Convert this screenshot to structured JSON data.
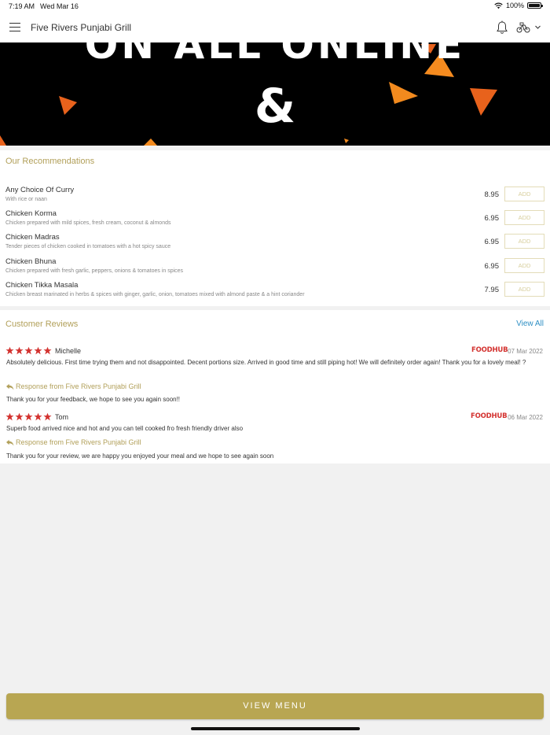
{
  "status_bar": {
    "time": "7:19 AM",
    "date": "Wed Mar 16",
    "battery": "100%"
  },
  "header": {
    "title": "Five Rivers Punjabi Grill"
  },
  "banner": {
    "text": "ON ALL ONLINE",
    "amp": "&"
  },
  "recommendations": {
    "title": "Our Recommendations",
    "add_label": "ADD",
    "items": [
      {
        "name": "Any Choice Of Curry",
        "description": "With rice or naan",
        "price": "8.95"
      },
      {
        "name": "Chicken Korma",
        "description": "Chicken prepared with mild spices, fresh cream, coconut & almonds",
        "price": "6.95"
      },
      {
        "name": "Chicken Madras",
        "description": "Tender pieces of chicken cooked in tomatoes with a hot spicy sauce",
        "price": "6.95"
      },
      {
        "name": "Chicken Bhuna",
        "description": "Chicken prepared with fresh garlic, peppers, onions & tomatoes in spices",
        "price": "6.95"
      },
      {
        "name": "Chicken Tikka Masala",
        "description": "Chicken breast marinated in herbs & spices with ginger, garlic, onion, tomatoes mixed with almond paste & a hint coriander",
        "price": "7.95"
      }
    ]
  },
  "reviews": {
    "title": "Customer Reviews",
    "view_all": "View All",
    "items": [
      {
        "rating": 5,
        "reviewer": "Michelle",
        "source": "FOODHUB",
        "date": "07 Mar 2022",
        "text": "Absolutely delicious. First time trying them and not disappointed. Decent portions size. Arrived in good time and still piping hot! We will definitely order again! Thank you for a lovely meal! ?",
        "response_label": "Response from Five Rivers Punjabi Grill",
        "response": "Thank you for your feedback, we hope to see you again soon!!"
      },
      {
        "rating": 5,
        "reviewer": "Tom",
        "source": "FOODHUB",
        "date": "06 Mar 2022",
        "text": "Superb food arrived nice and hot and you can tell cooked fro fresh friendly driver also",
        "response_label": "Response from Five Rivers Punjabi Grill",
        "response": "Thank you for your review, we are happy you enjoyed your meal and we hope to see again soon"
      }
    ]
  },
  "footer": {
    "view_menu": "VIEW MENU"
  },
  "colors": {
    "accent": "#b8a652",
    "link": "#2e8fc4",
    "star": "#d3322f",
    "foodhub": "#d3322f"
  },
  "icons": [
    "menu-icon",
    "bell-icon",
    "bike-icon",
    "chevron-down-icon",
    "wifi-icon",
    "battery-icon",
    "star-icon",
    "reply-icon"
  ]
}
